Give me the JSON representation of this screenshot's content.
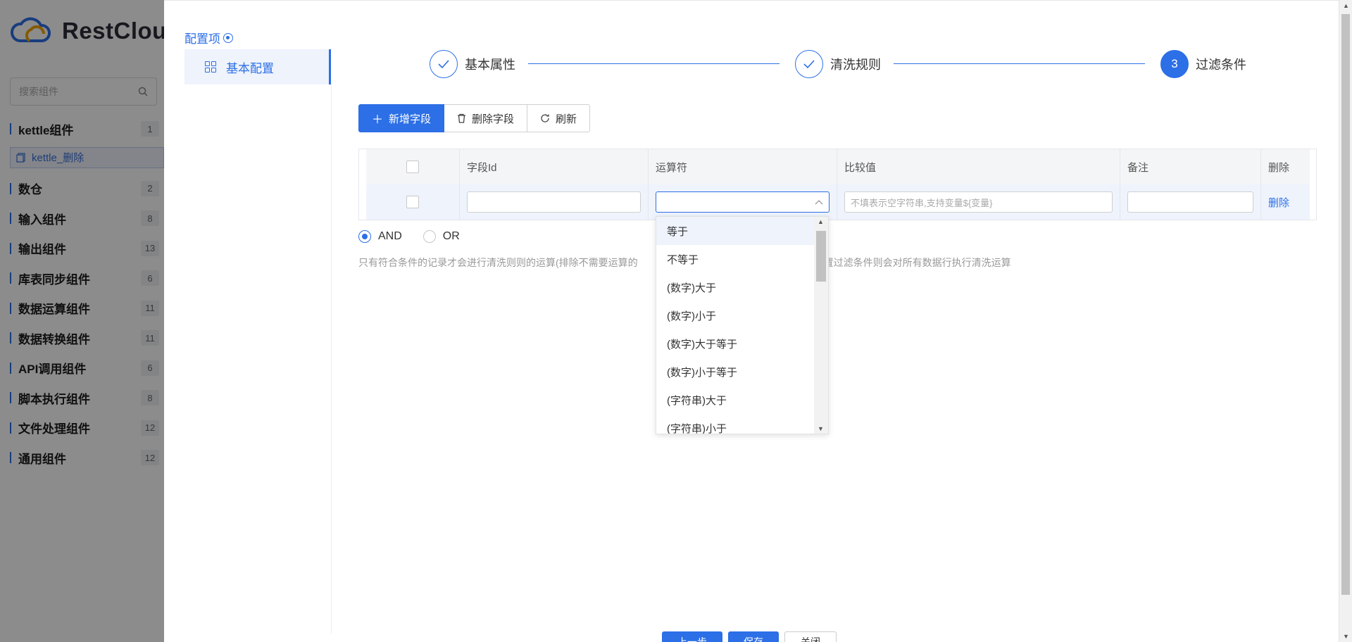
{
  "app": {
    "logo_text": "RestCloud"
  },
  "sidebar": {
    "search_placeholder": "搜索组件",
    "categories": [
      {
        "name": "kettle组件",
        "count": "1"
      },
      {
        "name": "数仓",
        "count": "2"
      },
      {
        "name": "输入组件",
        "count": "8"
      },
      {
        "name": "输出组件",
        "count": "13"
      },
      {
        "name": "库表同步组件",
        "count": "6"
      },
      {
        "name": "数据运算组件",
        "count": "11"
      },
      {
        "name": "数据转换组件",
        "count": "11"
      },
      {
        "name": "API调用组件",
        "count": "6"
      },
      {
        "name": "脚本执行组件",
        "count": "8"
      },
      {
        "name": "文件处理组件",
        "count": "12"
      },
      {
        "name": "通用组件",
        "count": "12"
      }
    ],
    "sub_item": "kettle_删除"
  },
  "drawer": {
    "config_title": "配置项",
    "menu_item": "基本配置",
    "steps": [
      {
        "label": "基本属性",
        "status": "done"
      },
      {
        "label": "清洗规则",
        "status": "done"
      },
      {
        "label": "过滤条件",
        "number": "3",
        "status": "active"
      }
    ],
    "toolbar": {
      "add": "新增字段",
      "delete": "删除字段",
      "refresh": "刷新"
    },
    "table": {
      "headers": {
        "field_id": "字段Id",
        "operator": "运算符",
        "compare": "比较值",
        "note": "备注",
        "delete": "删除"
      },
      "row": {
        "compare_placeholder": "不填表示空字符串,支持变量${变量}",
        "delete_link": "删除"
      }
    },
    "logic": {
      "and": "AND",
      "or": "OR",
      "selected": "AND"
    },
    "hint_left": "只有符合条件的记录才会进行清洗则则的运算(排除不需要运算的",
    "hint_right": "配置过滤条件则会对所有数据行执行清洗运算",
    "operator_options": [
      "等于",
      "不等于",
      "(数字)大于",
      "(数字)小于",
      "(数字)大于等于",
      "(数字)小于等于",
      "(字符串)大于",
      "(字符串)小于"
    ],
    "bottom_buttons": [
      "上一步",
      "保存",
      "关闭"
    ]
  },
  "colors": {
    "accent": "#2c6fe6",
    "overlay": "rgba(0,0,0,0.45)"
  }
}
